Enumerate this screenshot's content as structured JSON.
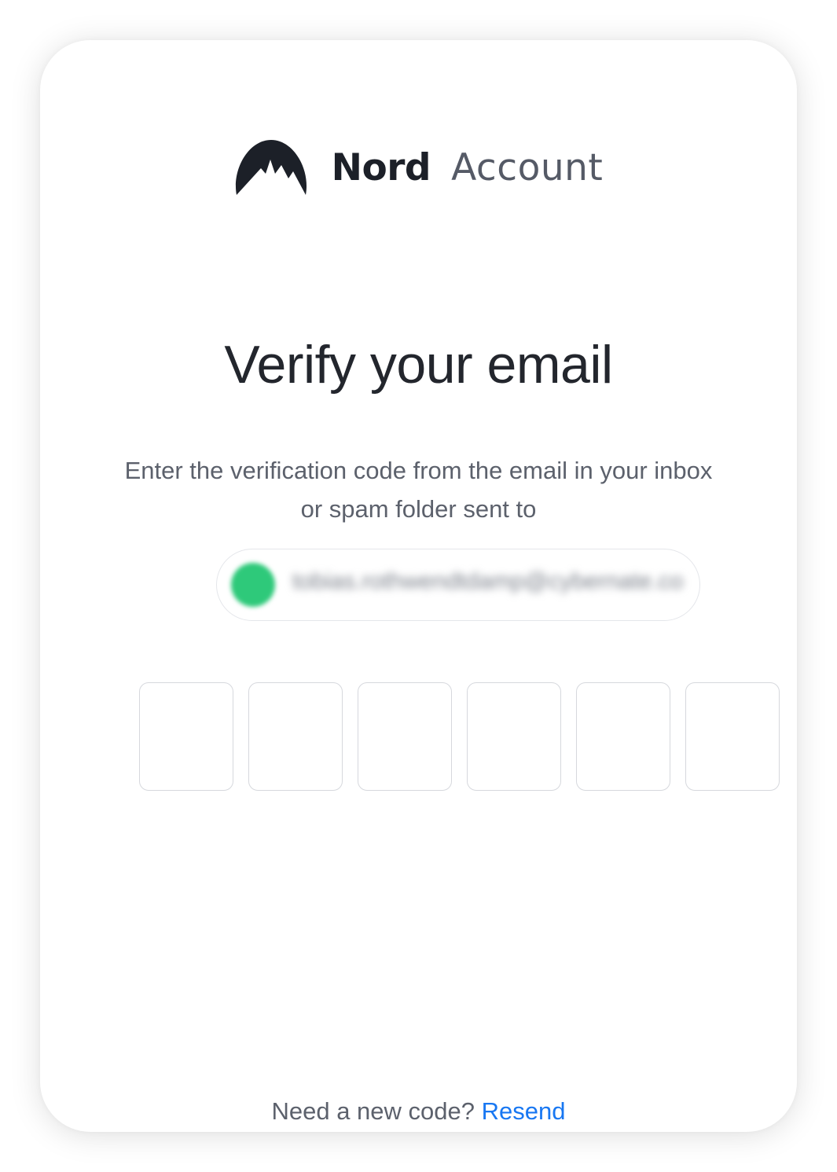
{
  "brand": {
    "logo_icon": "nord-mountain-logo-icon",
    "name": "Nord",
    "product": "Account"
  },
  "page": {
    "title": "Verify your email",
    "subtitle": "Enter the verification code from the email in your inbox or spam folder sent to"
  },
  "email": {
    "value": "tobias.rothwendtdamp@cybernate.co",
    "avatar_color": "#2ec97a"
  },
  "code_input": {
    "digits": [
      "",
      "",
      "",
      "",
      "",
      ""
    ]
  },
  "resend": {
    "prompt": "Need a new code?",
    "link_label": "Resend",
    "link_color": "#1877f2"
  }
}
